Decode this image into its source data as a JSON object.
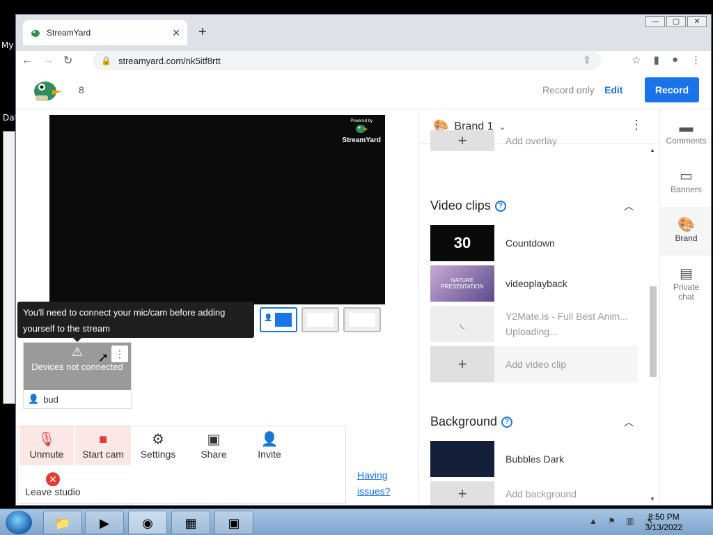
{
  "desktop": {
    "label_top": "My",
    "label_mid": "Dat"
  },
  "browser": {
    "tab_title": "StreamYard",
    "tab_close": "✕",
    "new_tab": "+",
    "url": "streamyard.com/nk5itf8rtt",
    "win_min": "—",
    "win_max": "▢",
    "win_close": "✕"
  },
  "header": {
    "studio_number": "8",
    "record_only": "Record only",
    "edit": "Edit",
    "record_button": "Record"
  },
  "stage": {
    "powered_by": "Powered by",
    "brand_mark": "StreamYard"
  },
  "tooltip": "You'll need to connect your mic/cam before adding yourself to the stream",
  "guest": {
    "status": "Devices not connected",
    "name": "bud"
  },
  "controls": {
    "unmute": "Unmute",
    "start_cam": "Start cam",
    "settings": "Settings",
    "share": "Share",
    "invite": "Invite",
    "leave": "Leave studio"
  },
  "having_issues": "Having issues?",
  "right_panel": {
    "brand_name": "Brand 1",
    "add_overlay": "Add overlay",
    "video_clips_title": "Video clips",
    "clips": [
      {
        "thumb": "30",
        "name": "Countdown"
      },
      {
        "thumb": "NATURE PRESENTATION",
        "name": "videoplayback"
      },
      {
        "name": "Y2Mate.is - Full Best Anim...",
        "status": "Uploading..."
      }
    ],
    "add_video_clip": "Add video clip",
    "background_title": "Background",
    "background_item": "Bubbles Dark",
    "add_background": "Add background"
  },
  "rail": {
    "comments": "Comments",
    "banners": "Banners",
    "brand": "Brand",
    "private_chat": "Private chat"
  },
  "taskbar": {
    "time": "8:50 PM",
    "date": "3/13/2022"
  },
  "colors": {
    "accent": "#1a73e8",
    "danger": "#e53935"
  }
}
